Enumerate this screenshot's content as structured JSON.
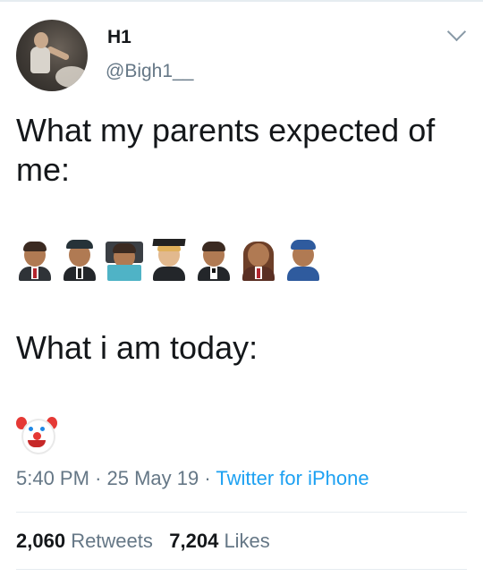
{
  "tweet": {
    "author": {
      "display_name": "H1",
      "handle": "@Bigh1__"
    },
    "text_line1": "What my parents expected of me:",
    "text_line2": "What i am today:",
    "expected_emojis": [
      "man-icon",
      "pilot-icon",
      "technologist-icon",
      "graduate-icon",
      "man-in-tuxedo-icon",
      "woman-icon",
      "police-officer-icon"
    ],
    "today_emoji": "clown-face-icon",
    "time": "5:40 PM",
    "date": "25 May 19",
    "source": "Twitter for iPhone",
    "retweets_count": "2,060",
    "retweets_label": "Retweets",
    "likes_count": "7,204",
    "likes_label": "Likes"
  },
  "colors": {
    "secondary_text": "#657786",
    "link": "#1da1f2",
    "divider": "#e6ecf0"
  }
}
